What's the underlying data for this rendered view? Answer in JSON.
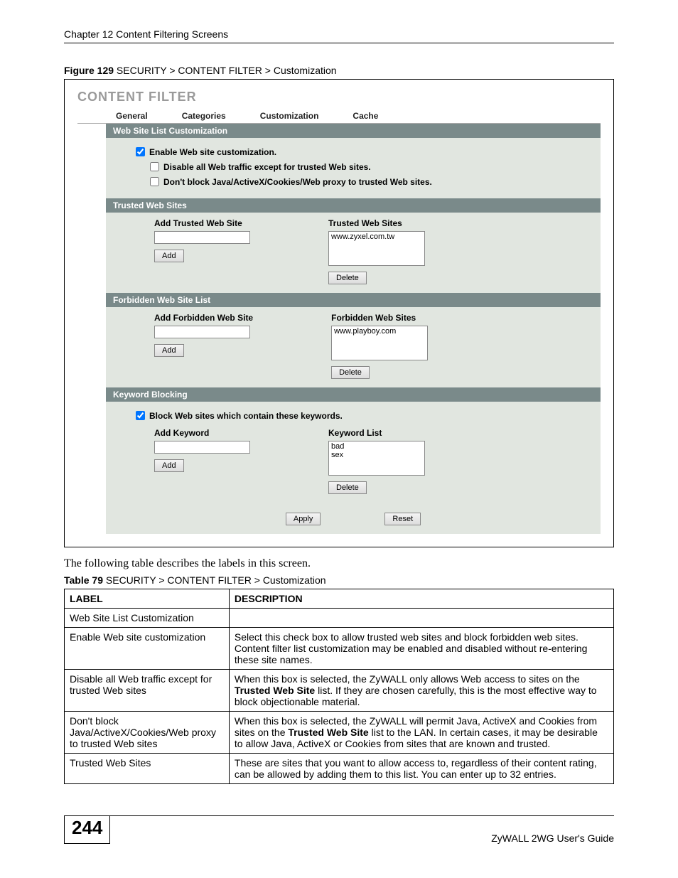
{
  "header": "Chapter 12 Content Filtering Screens",
  "figure_caption_bold": "Figure 129",
  "figure_caption_rest": "   SECURITY > CONTENT FILTER > Customization",
  "cf_title": "CONTENT FILTER",
  "tabs": {
    "general": "General",
    "categories": "Categories",
    "customization": "Customization",
    "cache": "Cache"
  },
  "section1": {
    "title": "Web Site List Customization",
    "cb1": "Enable Web site customization.",
    "cb2": "Disable all Web traffic except for trusted Web sites.",
    "cb3": "Don't block Java/ActiveX/Cookies/Web proxy to trusted Web sites."
  },
  "section2": {
    "title": "Trusted Web Sites",
    "add_label": "Add Trusted Web Site",
    "list_label": "Trusted Web Sites",
    "list_item": "www.zyxel.com.tw",
    "add_btn": "Add",
    "del_btn": "Delete"
  },
  "section3": {
    "title": "Forbidden Web Site List",
    "add_label": "Add Forbidden Web Site",
    "list_label": "Forbidden Web Sites",
    "list_item": "www.playboy.com",
    "add_btn": "Add",
    "del_btn": "Delete"
  },
  "section4": {
    "title": "Keyword Blocking",
    "cb": "Block Web sites which contain these keywords.",
    "add_label": "Add Keyword",
    "list_label": "Keyword List",
    "list_item1": "bad",
    "list_item2": "sex",
    "add_btn": "Add",
    "del_btn": "Delete"
  },
  "apply_btn": "Apply",
  "reset_btn": "Reset",
  "intro": "The following table describes the labels in this screen.",
  "table_caption_bold": "Table 79",
  "table_caption_rest": "   SECURITY > CONTENT FILTER > Customization",
  "th1": "LABEL",
  "th2": "DESCRIPTION",
  "rows": {
    "r1c1": "Web Site List Customization",
    "r1c2": "",
    "r2c1": "Enable Web site customization",
    "r2c2a": "Select this check box to allow trusted web sites and block forbidden web sites. Content filter list customization may be enabled and disabled without re-entering these site names.",
    "r3c1": "Disable all Web traffic except for trusted Web sites",
    "r3c2a": "When this box is selected, the ZyWALL only allows Web access to sites on the ",
    "r3c2b": "Trusted Web Site",
    "r3c2c": " list. If they are chosen carefully, this is the most effective way to block objectionable material.",
    "r4c1": "Don't block Java/ActiveX/Cookies/Web proxy to trusted Web sites",
    "r4c2a": "When this box is selected, the ZyWALL will permit Java, ActiveX and Cookies from sites on the ",
    "r4c2b": "Trusted Web Site",
    "r4c2c": " list to the LAN. In certain cases, it may be desirable to allow Java, ActiveX or Cookies from sites that are known and trusted.",
    "r5c1": "Trusted Web Sites",
    "r5c2": "These are sites that you want to allow access to, regardless of their content rating, can be allowed by adding them to this list. You can enter up to 32 entries."
  },
  "page_no": "244",
  "guide": "ZyWALL 2WG User's Guide"
}
